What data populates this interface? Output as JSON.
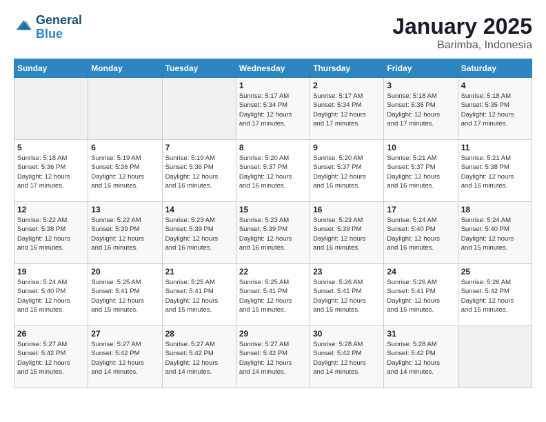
{
  "header": {
    "logo_line1": "General",
    "logo_line2": "Blue",
    "month": "January 2025",
    "location": "Barimba, Indonesia"
  },
  "weekdays": [
    "Sunday",
    "Monday",
    "Tuesday",
    "Wednesday",
    "Thursday",
    "Friday",
    "Saturday"
  ],
  "weeks": [
    [
      {
        "day": "",
        "info": ""
      },
      {
        "day": "",
        "info": ""
      },
      {
        "day": "",
        "info": ""
      },
      {
        "day": "1",
        "info": "Sunrise: 5:17 AM\nSunset: 5:34 PM\nDaylight: 12 hours\nand 17 minutes."
      },
      {
        "day": "2",
        "info": "Sunrise: 5:17 AM\nSunset: 5:34 PM\nDaylight: 12 hours\nand 17 minutes."
      },
      {
        "day": "3",
        "info": "Sunrise: 5:18 AM\nSunset: 5:35 PM\nDaylight: 12 hours\nand 17 minutes."
      },
      {
        "day": "4",
        "info": "Sunrise: 5:18 AM\nSunset: 5:35 PM\nDaylight: 12 hours\nand 17 minutes."
      }
    ],
    [
      {
        "day": "5",
        "info": "Sunrise: 5:18 AM\nSunset: 5:36 PM\nDaylight: 12 hours\nand 17 minutes."
      },
      {
        "day": "6",
        "info": "Sunrise: 5:19 AM\nSunset: 5:36 PM\nDaylight: 12 hours\nand 16 minutes."
      },
      {
        "day": "7",
        "info": "Sunrise: 5:19 AM\nSunset: 5:36 PM\nDaylight: 12 hours\nand 16 minutes."
      },
      {
        "day": "8",
        "info": "Sunrise: 5:20 AM\nSunset: 5:37 PM\nDaylight: 12 hours\nand 16 minutes."
      },
      {
        "day": "9",
        "info": "Sunrise: 5:20 AM\nSunset: 5:37 PM\nDaylight: 12 hours\nand 16 minutes."
      },
      {
        "day": "10",
        "info": "Sunrise: 5:21 AM\nSunset: 5:37 PM\nDaylight: 12 hours\nand 16 minutes."
      },
      {
        "day": "11",
        "info": "Sunrise: 5:21 AM\nSunset: 5:38 PM\nDaylight: 12 hours\nand 16 minutes."
      }
    ],
    [
      {
        "day": "12",
        "info": "Sunrise: 5:22 AM\nSunset: 5:38 PM\nDaylight: 12 hours\nand 16 minutes."
      },
      {
        "day": "13",
        "info": "Sunrise: 5:22 AM\nSunset: 5:39 PM\nDaylight: 12 hours\nand 16 minutes."
      },
      {
        "day": "14",
        "info": "Sunrise: 5:23 AM\nSunset: 5:39 PM\nDaylight: 12 hours\nand 16 minutes."
      },
      {
        "day": "15",
        "info": "Sunrise: 5:23 AM\nSunset: 5:39 PM\nDaylight: 12 hours\nand 16 minutes."
      },
      {
        "day": "16",
        "info": "Sunrise: 5:23 AM\nSunset: 5:39 PM\nDaylight: 12 hours\nand 16 minutes."
      },
      {
        "day": "17",
        "info": "Sunrise: 5:24 AM\nSunset: 5:40 PM\nDaylight: 12 hours\nand 16 minutes."
      },
      {
        "day": "18",
        "info": "Sunrise: 5:24 AM\nSunset: 5:40 PM\nDaylight: 12 hours\nand 15 minutes."
      }
    ],
    [
      {
        "day": "19",
        "info": "Sunrise: 5:24 AM\nSunset: 5:40 PM\nDaylight: 12 hours\nand 15 minutes."
      },
      {
        "day": "20",
        "info": "Sunrise: 5:25 AM\nSunset: 5:41 PM\nDaylight: 12 hours\nand 15 minutes."
      },
      {
        "day": "21",
        "info": "Sunrise: 5:25 AM\nSunset: 5:41 PM\nDaylight: 12 hours\nand 15 minutes."
      },
      {
        "day": "22",
        "info": "Sunrise: 5:25 AM\nSunset: 5:41 PM\nDaylight: 12 hours\nand 15 minutes."
      },
      {
        "day": "23",
        "info": "Sunrise: 5:26 AM\nSunset: 5:41 PM\nDaylight: 12 hours\nand 15 minutes."
      },
      {
        "day": "24",
        "info": "Sunrise: 5:26 AM\nSunset: 5:41 PM\nDaylight: 12 hours\nand 15 minutes."
      },
      {
        "day": "25",
        "info": "Sunrise: 5:26 AM\nSunset: 5:42 PM\nDaylight: 12 hours\nand 15 minutes."
      }
    ],
    [
      {
        "day": "26",
        "info": "Sunrise: 5:27 AM\nSunset: 5:42 PM\nDaylight: 12 hours\nand 15 minutes."
      },
      {
        "day": "27",
        "info": "Sunrise: 5:27 AM\nSunset: 5:42 PM\nDaylight: 12 hours\nand 14 minutes."
      },
      {
        "day": "28",
        "info": "Sunrise: 5:27 AM\nSunset: 5:42 PM\nDaylight: 12 hours\nand 14 minutes."
      },
      {
        "day": "29",
        "info": "Sunrise: 5:27 AM\nSunset: 5:42 PM\nDaylight: 12 hours\nand 14 minutes."
      },
      {
        "day": "30",
        "info": "Sunrise: 5:28 AM\nSunset: 5:42 PM\nDaylight: 12 hours\nand 14 minutes."
      },
      {
        "day": "31",
        "info": "Sunrise: 5:28 AM\nSunset: 5:42 PM\nDaylight: 12 hours\nand 14 minutes."
      },
      {
        "day": "",
        "info": ""
      }
    ]
  ]
}
